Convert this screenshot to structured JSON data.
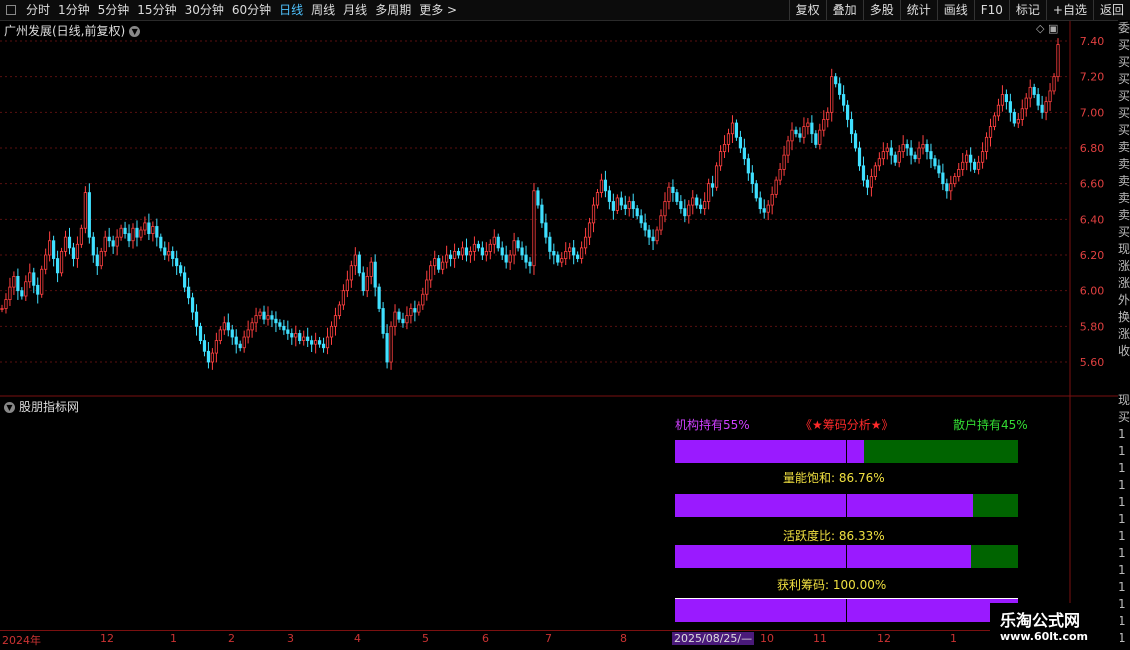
{
  "toolbar": {
    "periods": [
      "分时",
      "1分钟",
      "5分钟",
      "15分钟",
      "30分钟",
      "60分钟",
      "日线",
      "周线",
      "月线",
      "多周期",
      "更多 >"
    ],
    "active_period": "日线",
    "right_buttons": [
      "复权",
      "叠加",
      "多股",
      "统计",
      "画线",
      "F10",
      "标记",
      "+自选",
      "返回"
    ]
  },
  "stock_title": "广州发展(日线,前复权)",
  "corner_icons": "◇ ▣",
  "right_strip_chars": [
    "委",
    "买",
    "买",
    "买",
    "买",
    "买",
    "买",
    "卖",
    "卖",
    "卖",
    "卖",
    "卖",
    "买",
    "现",
    "涨",
    "涨",
    "外",
    "换",
    "涨",
    "收"
  ],
  "right_strip_lower": [
    "现",
    "买",
    "1",
    "1",
    "1",
    "1",
    "1",
    "1",
    "1",
    "1",
    "1",
    "1",
    "1",
    "1",
    "1",
    "1"
  ],
  "indicator": {
    "title": "股朋指标网",
    "inst_label": "机构持有55%",
    "center_label": "《★筹码分析★》",
    "retail_label": "散户持有45%",
    "volume_saturation_label": "量能饱和:  86.76%",
    "activity_label": "活跃度比:  86.33%",
    "profit_label": "获利筹码:  100.00%",
    "bars": [
      {
        "name": "inst-vs-retail",
        "fill": 0.55
      },
      {
        "name": "volume-saturation",
        "fill": 0.8676
      },
      {
        "name": "activity-ratio",
        "fill": 0.8633
      },
      {
        "name": "profit-chips",
        "fill": 1.0
      }
    ],
    "colors": {
      "fill": "#9a1aff",
      "rest": "#006400",
      "inst": "#d040ff",
      "center": "#ff2a2a",
      "retail": "#33dd33",
      "stat": "#f0e040"
    }
  },
  "xaxis": {
    "labels": [
      "2024年",
      "12",
      "1",
      "2",
      "3",
      "4",
      "5",
      "6",
      "7",
      "8",
      "2025/08/25/—",
      "10",
      "11",
      "12",
      "1"
    ],
    "cursor_label": "2025/08/25/—"
  },
  "watermark": {
    "line1": "乐淘公式网",
    "line2": "www.60lt.com"
  },
  "chart_data": {
    "type": "candlestick",
    "y_ticks": [
      "7.40",
      "7.20",
      "7.00",
      "6.80",
      "6.60",
      "6.40",
      "6.20",
      "6.00",
      "5.80",
      "5.60"
    ],
    "ylim": [
      5.5,
      7.45
    ],
    "colors": {
      "up": "#ff4040",
      "down": "#40e0ff",
      "grid": "#5a1010",
      "axis": "#e04040"
    },
    "closes": [
      5.9,
      5.95,
      6.02,
      6.08,
      6.0,
      5.97,
      6.05,
      6.1,
      6.03,
      5.98,
      6.12,
      6.2,
      6.28,
      6.18,
      6.1,
      6.22,
      6.3,
      6.24,
      6.18,
      6.26,
      6.35,
      6.55,
      6.3,
      6.2,
      6.14,
      6.22,
      6.3,
      6.28,
      6.25,
      6.3,
      6.35,
      6.32,
      6.28,
      6.35,
      6.3,
      6.34,
      6.38,
      6.32,
      6.36,
      6.3,
      6.24,
      6.2,
      6.22,
      6.18,
      6.14,
      6.1,
      6.02,
      5.96,
      5.88,
      5.8,
      5.72,
      5.66,
      5.6,
      5.65,
      5.72,
      5.78,
      5.82,
      5.78,
      5.74,
      5.7,
      5.68,
      5.74,
      5.78,
      5.82,
      5.86,
      5.88,
      5.84,
      5.86,
      5.84,
      5.82,
      5.8,
      5.78,
      5.76,
      5.74,
      5.76,
      5.72,
      5.74,
      5.72,
      5.7,
      5.72,
      5.7,
      5.68,
      5.74,
      5.8,
      5.86,
      5.92,
      6.0,
      6.06,
      6.14,
      6.2,
      6.1,
      6.0,
      6.08,
      6.16,
      6.02,
      5.9,
      5.76,
      5.6,
      5.8,
      5.88,
      5.84,
      5.82,
      5.86,
      5.9,
      5.88,
      5.92,
      5.98,
      6.06,
      6.14,
      6.18,
      6.12,
      6.16,
      6.2,
      6.18,
      6.22,
      6.2,
      6.24,
      6.2,
      6.22,
      6.26,
      6.24,
      6.2,
      6.22,
      6.26,
      6.3,
      6.24,
      6.2,
      6.16,
      6.2,
      6.28,
      6.24,
      6.2,
      6.16,
      6.14,
      6.56,
      6.48,
      6.38,
      6.3,
      6.22,
      6.2,
      6.16,
      6.18,
      6.22,
      6.24,
      6.2,
      6.18,
      6.24,
      6.3,
      6.38,
      6.48,
      6.55,
      6.62,
      6.56,
      6.5,
      6.45,
      6.52,
      6.48,
      6.46,
      6.5,
      6.46,
      6.42,
      6.38,
      6.34,
      6.3,
      6.28,
      6.34,
      6.42,
      6.5,
      6.58,
      6.55,
      6.5,
      6.46,
      6.42,
      6.48,
      6.52,
      6.48,
      6.46,
      6.5,
      6.6,
      6.58,
      6.7,
      6.78,
      6.82,
      6.88,
      6.94,
      6.86,
      6.8,
      6.74,
      6.66,
      6.6,
      6.52,
      6.46,
      6.44,
      6.48,
      6.54,
      6.62,
      6.68,
      6.76,
      6.84,
      6.9,
      6.88,
      6.86,
      6.92,
      6.94,
      6.88,
      6.82,
      6.9,
      6.96,
      7.0,
      7.2,
      7.16,
      7.1,
      7.04,
      6.96,
      6.88,
      6.8,
      6.7,
      6.62,
      6.58,
      6.64,
      6.7,
      6.74,
      6.78,
      6.8,
      6.76,
      6.72,
      6.78,
      6.82,
      6.8,
      6.76,
      6.74,
      6.8,
      6.82,
      6.78,
      6.74,
      6.7,
      6.66,
      6.6,
      6.56,
      6.6,
      6.64,
      6.68,
      6.72,
      6.76,
      6.72,
      6.68,
      6.72,
      6.78,
      6.86,
      6.92,
      6.98,
      7.04,
      7.1,
      7.06,
      7.0,
      6.94,
      6.96,
      7.02,
      7.08,
      7.14,
      7.1,
      7.04,
      7.0,
      7.06,
      7.12,
      7.2,
      7.38
    ]
  }
}
